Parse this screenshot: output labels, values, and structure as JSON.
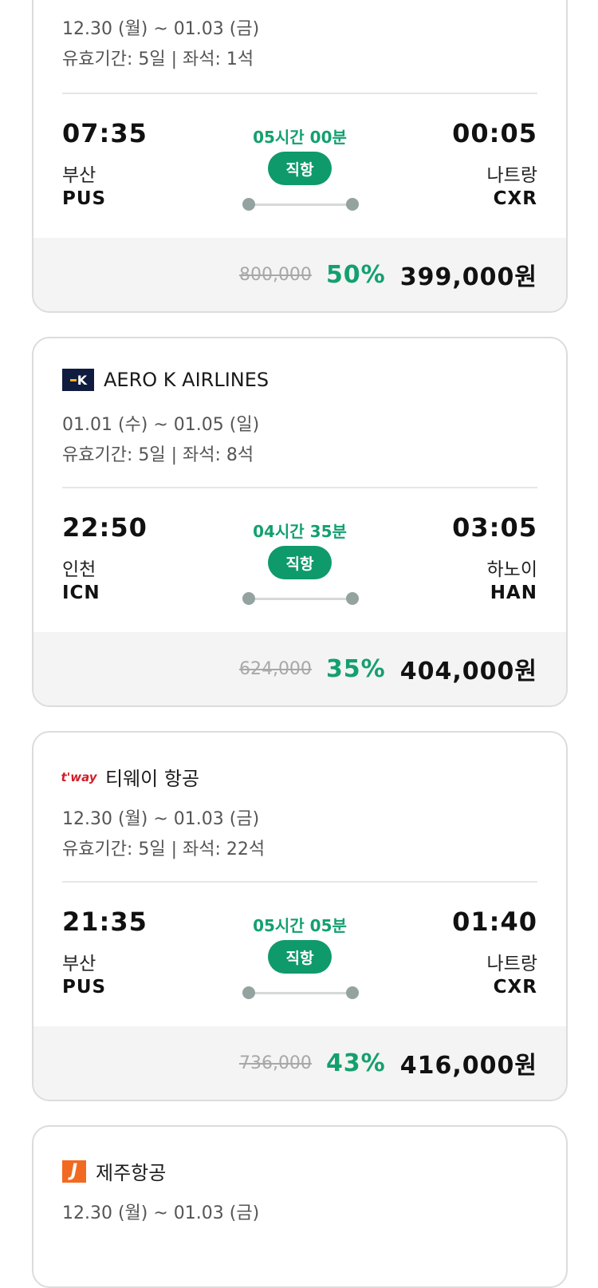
{
  "cards": [
    {
      "dates": "12.30 (월) ~ 01.03 (금)",
      "validity": "유효기간: 5일 | 좌석: 1석",
      "dep_time": "07:35",
      "dep_city": "부산",
      "dep_code": "PUS",
      "arr_time": "00:05",
      "arr_city": "나트랑",
      "arr_code": "CXR",
      "duration": "05시간 00분",
      "direct": "직항",
      "orig_price": "800,000",
      "discount": "50%",
      "price": "399,000원"
    },
    {
      "airline": "AERO K AIRLINES",
      "logo": "aerok-logo",
      "logo_text": "K",
      "dates": "01.01 (수) ~ 01.05 (일)",
      "validity": "유효기간: 5일 | 좌석: 8석",
      "dep_time": "22:50",
      "dep_city": "인천",
      "dep_code": "ICN",
      "arr_time": "03:05",
      "arr_city": "하노이",
      "arr_code": "HAN",
      "duration": "04시간 35분",
      "direct": "직항",
      "orig_price": "624,000",
      "discount": "35%",
      "price": "404,000원"
    },
    {
      "airline": "티웨이 항공",
      "logo": "tway-logo",
      "logo_text": "t'way",
      "dates": "12.30 (월) ~ 01.03 (금)",
      "validity": "유효기간: 5일 | 좌석: 22석",
      "dep_time": "21:35",
      "dep_city": "부산",
      "dep_code": "PUS",
      "arr_time": "01:40",
      "arr_city": "나트랑",
      "arr_code": "CXR",
      "duration": "05시간 05분",
      "direct": "직항",
      "orig_price": "736,000",
      "discount": "43%",
      "price": "416,000원"
    },
    {
      "airline": "제주항공",
      "logo": "jejuair-logo",
      "logo_text": "J",
      "dates": "12.30 (월) ~ 01.03 (금)"
    }
  ]
}
